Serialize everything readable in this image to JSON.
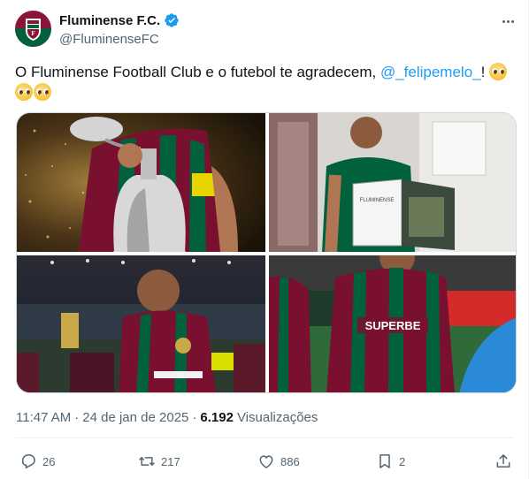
{
  "account": {
    "display_name": "Fluminense F.C.",
    "handle": "@FluminenseFC",
    "verified": true,
    "avatar_icon": "fluminense-crest-icon",
    "brand_colors": [
      "#8a1538",
      "#00613c",
      "#ffffff"
    ]
  },
  "tweet": {
    "text_prefix": "O Fluminense Football Club e o futebol te agradecem, ",
    "mention": "@_felipemelo_",
    "text_suffix": "!",
    "emojis": [
      "pleading-face",
      "pleading-face",
      "pleading-face"
    ]
  },
  "media": [
    {
      "icon": "photo-trophy-celebration"
    },
    {
      "icon": "photo-player-holding-magazine"
    },
    {
      "icon": "photo-player-with-medal"
    },
    {
      "icon": "photo-players-on-pitch"
    }
  ],
  "meta": {
    "time": "11:47 AM",
    "separator": "·",
    "date": "24 de jan de 2025",
    "separator2": "·",
    "views_count": "6.192",
    "views_label": "Visualizações"
  },
  "actions": {
    "replies": "26",
    "reposts": "217",
    "likes": "886",
    "bookmarks": "2"
  },
  "colors": {
    "link": "#1d9bf0",
    "secondary_text": "#536471",
    "primary_text": "#0f1419",
    "border": "#cfd9de"
  }
}
